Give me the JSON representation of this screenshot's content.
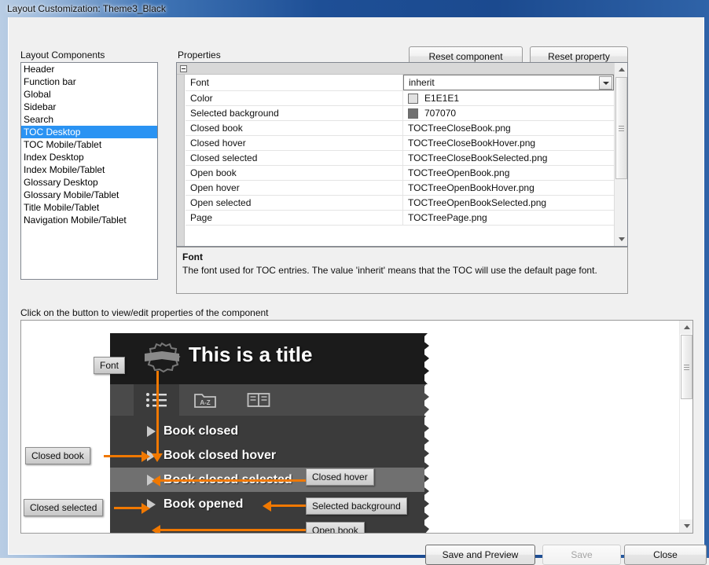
{
  "window": {
    "title": "Layout Customization: Theme3_Black"
  },
  "sections": {
    "components_label": "Layout Components",
    "properties_label": "Properties",
    "hint": "Click on the button to view/edit properties of the component"
  },
  "toolbar": {
    "reset_component": "Reset component",
    "reset_property": "Reset property"
  },
  "components": [
    {
      "label": "Header",
      "selected": false
    },
    {
      "label": "Function bar",
      "selected": false
    },
    {
      "label": "Global",
      "selected": false
    },
    {
      "label": "Sidebar",
      "selected": false
    },
    {
      "label": "Search",
      "selected": false
    },
    {
      "label": "TOC Desktop",
      "selected": true
    },
    {
      "label": "TOC Mobile/Tablet",
      "selected": false
    },
    {
      "label": "Index Desktop",
      "selected": false
    },
    {
      "label": "Index Mobile/Tablet",
      "selected": false
    },
    {
      "label": "Glossary Desktop",
      "selected": false
    },
    {
      "label": "Glossary Mobile/Tablet",
      "selected": false
    },
    {
      "label": "Title Mobile/Tablet",
      "selected": false
    },
    {
      "label": "Navigation Mobile/Tablet",
      "selected": false
    }
  ],
  "properties": [
    {
      "name": "Font",
      "value": "inherit",
      "kind": "combo"
    },
    {
      "name": "Color",
      "value": "E1E1E1",
      "kind": "color",
      "swatch": "#e1e1e1"
    },
    {
      "name": "Selected background",
      "value": "707070",
      "kind": "color",
      "swatch": "#707070"
    },
    {
      "name": "Closed book",
      "value": "TOCTreeCloseBook.png",
      "kind": "text"
    },
    {
      "name": "Closed hover",
      "value": "TOCTreeCloseBookHover.png",
      "kind": "text"
    },
    {
      "name": "Closed selected",
      "value": "TOCTreeCloseBookSelected.png",
      "kind": "text"
    },
    {
      "name": "Open book",
      "value": "TOCTreeOpenBook.png",
      "kind": "text"
    },
    {
      "name": "Open hover",
      "value": "TOCTreeOpenBookHover.png",
      "kind": "text"
    },
    {
      "name": "Open selected",
      "value": "TOCTreeOpenBookSelected.png",
      "kind": "text"
    },
    {
      "name": "Page",
      "value": "TOCTreePage.png",
      "kind": "text"
    }
  ],
  "description": {
    "title": "Font",
    "text": "The font used for TOC entries. The value 'inherit' means that the TOC will use the default page font."
  },
  "preview": {
    "title": "This is a title",
    "tree": [
      {
        "label": "Book closed"
      },
      {
        "label": "Book closed hover"
      },
      {
        "label": "Book closed selected"
      },
      {
        "label": "Book opened"
      }
    ],
    "callouts": {
      "font": "Font",
      "closed_book": "Closed book",
      "closed_selected": "Closed selected",
      "closed_hover": "Closed hover",
      "selected_background": "Selected background",
      "open_book": "Open book"
    },
    "colors": {
      "accent": "#f07800",
      "header_bg": "#1b1b1b",
      "toolbar_bg": "#4a4a4a",
      "tree_bg": "#3b3b3b",
      "selected_bg": "#707070",
      "text": "#e1e1e1"
    }
  },
  "footer": {
    "save_and_preview": "Save and Preview",
    "save": "Save",
    "close": "Close"
  }
}
